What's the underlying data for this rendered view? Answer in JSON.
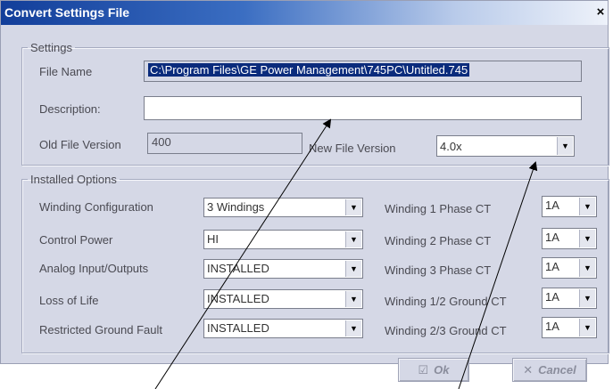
{
  "window": {
    "title": "Convert Settings File",
    "close_glyph": "×"
  },
  "settings": {
    "legend": "Settings",
    "file_name_label": "File Name",
    "file_name_value": "C:\\Program Files\\GE Power Management\\745PC\\Untitled.745",
    "description_label": "Description:",
    "description_value": "",
    "old_version_label": "Old File Version",
    "old_version_value": "400",
    "new_version_label": "New File Version",
    "new_version_value": "4.0x"
  },
  "options": {
    "legend": "Installed Options",
    "left": [
      {
        "label": "Winding Configuration",
        "value": "3 Windings"
      },
      {
        "label": "Control Power",
        "value": "HI"
      },
      {
        "label": "Analog Input/Outputs",
        "value": "INSTALLED"
      },
      {
        "label": "Loss of Life",
        "value": "INSTALLED"
      },
      {
        "label": "Restricted Ground Fault",
        "value": "INSTALLED"
      }
    ],
    "right": [
      {
        "label": "Winding 1 Phase CT",
        "value": "1A"
      },
      {
        "label": "Winding 2 Phase CT",
        "value": "1A"
      },
      {
        "label": "Winding 3 Phase CT",
        "value": "1A"
      },
      {
        "label": "Winding 1/2 Ground CT",
        "value": "1A"
      },
      {
        "label": "Winding 2/3 Ground CT",
        "value": "1A"
      }
    ]
  },
  "buttons": {
    "ok_label": "Ok",
    "ok_icon": "checkbox-check-icon",
    "cancel_label": "Cancel",
    "cancel_icon": "x-icon"
  },
  "icons": {
    "dropdown": "triangle-down-icon"
  }
}
